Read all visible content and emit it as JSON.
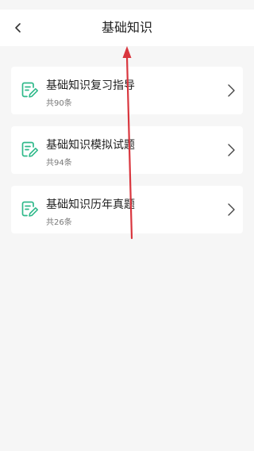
{
  "header": {
    "title": "基础知识",
    "back_icon": "chevron-left-icon"
  },
  "cards": [
    {
      "title": "基础知识复习指导",
      "count": "共90条",
      "icon": "edit-document-icon"
    },
    {
      "title": "基础知识模拟试题",
      "count": "共94条",
      "icon": "edit-document-icon"
    },
    {
      "title": "基础知识历年真题",
      "count": "共26条",
      "icon": "edit-document-icon"
    }
  ],
  "colors": {
    "accent": "#2fb98a",
    "annotation_arrow": "#d9363e",
    "background": "#f6f6f6",
    "card": "#ffffff"
  }
}
